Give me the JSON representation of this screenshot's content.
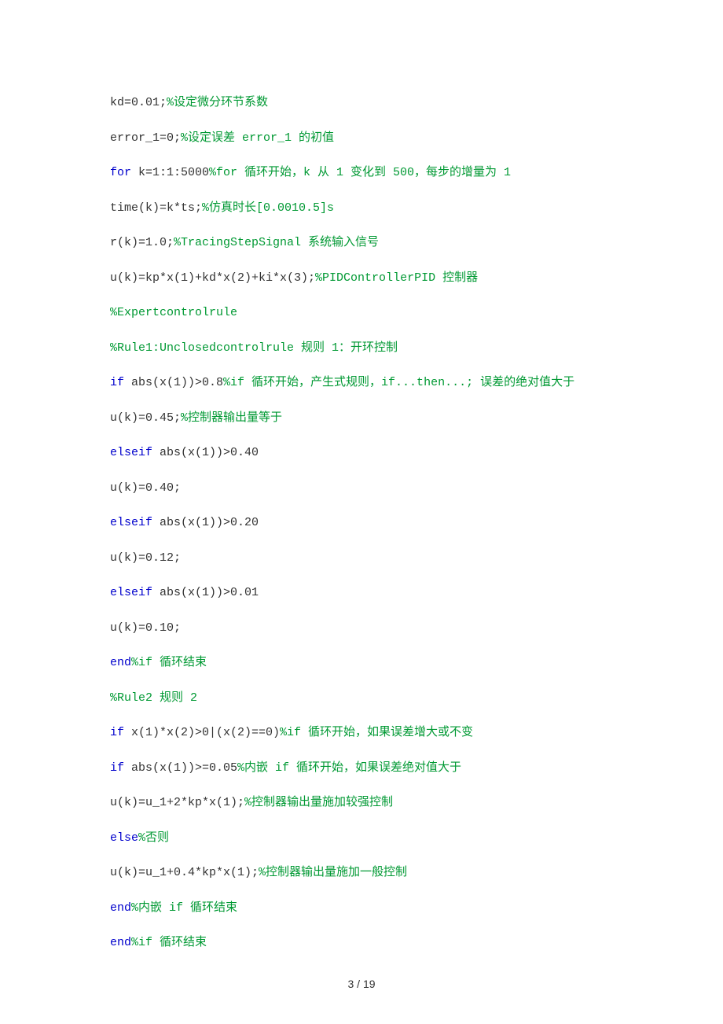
{
  "lines": [
    {
      "segments": [
        {
          "cls": "txt",
          "t": "kd=0.01;"
        },
        {
          "cls": "cmt",
          "t": "%设定微分环节系数"
        }
      ]
    },
    {
      "segments": [
        {
          "cls": "txt",
          "t": "error_1=0;"
        },
        {
          "cls": "cmt",
          "t": "%设定误差 error_1 的初值"
        }
      ]
    },
    {
      "segments": [
        {
          "cls": "kw",
          "t": "for "
        },
        {
          "cls": "txt",
          "t": "k=1:1:5000"
        },
        {
          "cls": "cmt",
          "t": "%for 循环开始，k 从 1 变化到 500，每步的增量为 1"
        }
      ]
    },
    {
      "segments": [
        {
          "cls": "txt",
          "t": "time(k)=k*ts;"
        },
        {
          "cls": "cmt",
          "t": "%仿真时长[0.0010.5]s"
        }
      ]
    },
    {
      "segments": [
        {
          "cls": "txt",
          "t": "r(k)=1.0;"
        },
        {
          "cls": "cmt",
          "t": "%TracingStepSignal 系统输入信号"
        }
      ]
    },
    {
      "segments": [
        {
          "cls": "txt",
          "t": "u(k)=kp*x(1)+kd*x(2)+ki*x(3);"
        },
        {
          "cls": "cmt",
          "t": "%PIDControllerPID 控制器"
        }
      ]
    },
    {
      "segments": [
        {
          "cls": "cmt",
          "t": "%Expertcontrolrule"
        }
      ]
    },
    {
      "segments": [
        {
          "cls": "cmt",
          "t": "%Rule1:Unclosedcontrolrule 规则 1：开环控制"
        }
      ]
    },
    {
      "segments": [
        {
          "cls": "kw",
          "t": "if "
        },
        {
          "cls": "txt",
          "t": "abs(x(1))>0.8"
        },
        {
          "cls": "cmt",
          "t": "%if 循环开始，产生式规则，if...then...; 误差的绝对值大于"
        }
      ]
    },
    {
      "segments": [
        {
          "cls": "txt",
          "t": "u(k)=0.45;"
        },
        {
          "cls": "cmt",
          "t": "%控制器输出量等于"
        }
      ]
    },
    {
      "segments": [
        {
          "cls": "kw",
          "t": "elseif "
        },
        {
          "cls": "txt",
          "t": "abs(x(1))>0.40"
        }
      ]
    },
    {
      "segments": [
        {
          "cls": "txt",
          "t": "u(k)=0.40;"
        }
      ]
    },
    {
      "segments": [
        {
          "cls": "kw",
          "t": "elseif "
        },
        {
          "cls": "txt",
          "t": "abs(x(1))>0.20"
        }
      ]
    },
    {
      "segments": [
        {
          "cls": "txt",
          "t": "u(k)=0.12;"
        }
      ]
    },
    {
      "segments": [
        {
          "cls": "kw",
          "t": "elseif "
        },
        {
          "cls": "txt",
          "t": "abs(x(1))>0.01"
        }
      ]
    },
    {
      "segments": [
        {
          "cls": "txt",
          "t": "u(k)=0.10;"
        }
      ]
    },
    {
      "segments": [
        {
          "cls": "kw",
          "t": "end"
        },
        {
          "cls": "cmt",
          "t": "%if 循环结束"
        }
      ]
    },
    {
      "segments": [
        {
          "cls": "cmt",
          "t": "%Rule2 规则 2"
        }
      ]
    },
    {
      "segments": [
        {
          "cls": "kw",
          "t": "if "
        },
        {
          "cls": "txt",
          "t": "x(1)*x(2)>0|(x(2)==0)"
        },
        {
          "cls": "cmt",
          "t": "%if 循环开始，如果误差增大或不变"
        }
      ]
    },
    {
      "segments": [
        {
          "cls": "kw",
          "t": "if "
        },
        {
          "cls": "txt",
          "t": "abs(x(1))>=0.05"
        },
        {
          "cls": "cmt",
          "t": "%内嵌 if 循环开始，如果误差绝对值大于"
        }
      ]
    },
    {
      "segments": [
        {
          "cls": "txt",
          "t": "u(k)=u_1+2*kp*x(1);"
        },
        {
          "cls": "cmt",
          "t": "%控制器输出量施加较强控制"
        }
      ]
    },
    {
      "segments": [
        {
          "cls": "kw",
          "t": "else"
        },
        {
          "cls": "cmt",
          "t": "%否则"
        }
      ]
    },
    {
      "segments": [
        {
          "cls": "txt",
          "t": "u(k)=u_1+0.4*kp*x(1);"
        },
        {
          "cls": "cmt",
          "t": "%控制器输出量施加一般控制"
        }
      ]
    },
    {
      "segments": [
        {
          "cls": "kw",
          "t": "end"
        },
        {
          "cls": "cmt",
          "t": "%内嵌 if 循环结束"
        }
      ]
    },
    {
      "segments": [
        {
          "cls": "kw",
          "t": "end"
        },
        {
          "cls": "cmt",
          "t": "%if 循环结束"
        }
      ]
    }
  ],
  "footer": "3 / 19"
}
